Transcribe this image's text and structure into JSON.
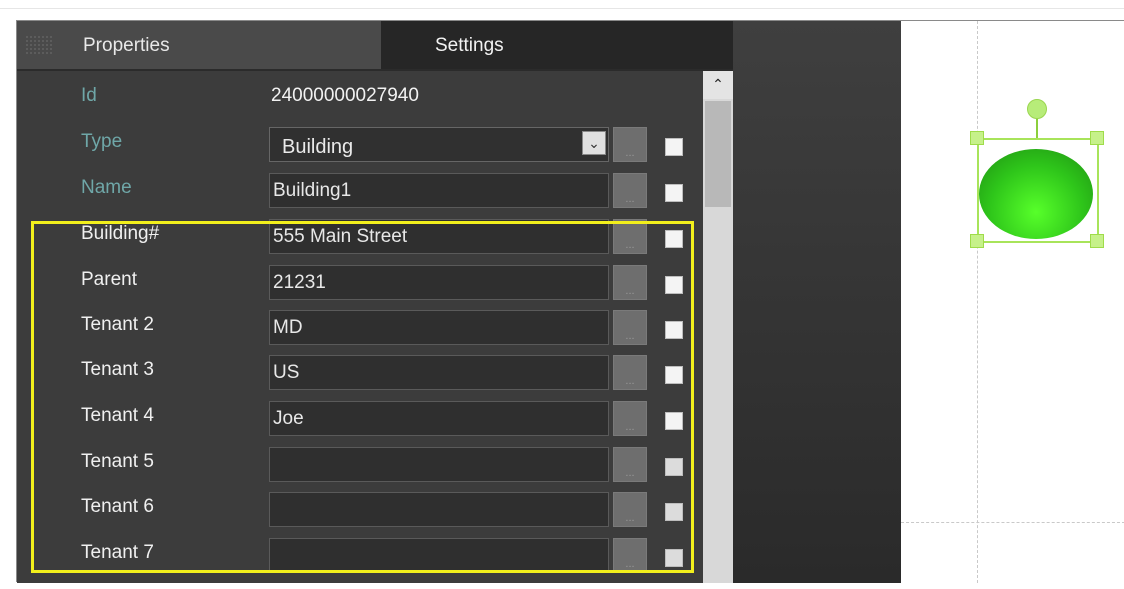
{
  "tabs": [
    {
      "label": "Properties"
    },
    {
      "label": "Settings"
    }
  ],
  "properties": {
    "id": {
      "label": "Id",
      "value": "24000000027940"
    },
    "type": {
      "label": "Type",
      "value": "Building"
    },
    "name": {
      "label": "Name",
      "value": "Building1"
    },
    "rows": [
      {
        "label": "Building#",
        "value": "555 Main Street"
      },
      {
        "label": "Parent",
        "value": "21231"
      },
      {
        "label": "Tenant 2",
        "value": "MD"
      },
      {
        "label": "Tenant 3",
        "value": "US"
      },
      {
        "label": "Tenant 4",
        "value": "Joe"
      },
      {
        "label": "Tenant 5",
        "value": ""
      },
      {
        "label": "Tenant 6",
        "value": ""
      },
      {
        "label": "Tenant 7",
        "value": ""
      }
    ],
    "ellipsis_label": "...",
    "dropdown_icon": "chevron-down-icon",
    "scroll_up_icon": "chevron-up-icon"
  },
  "colors": {
    "highlight": "#f2ef1c",
    "shape_fill": "#2ec51a",
    "selection": "#a8e45a"
  }
}
